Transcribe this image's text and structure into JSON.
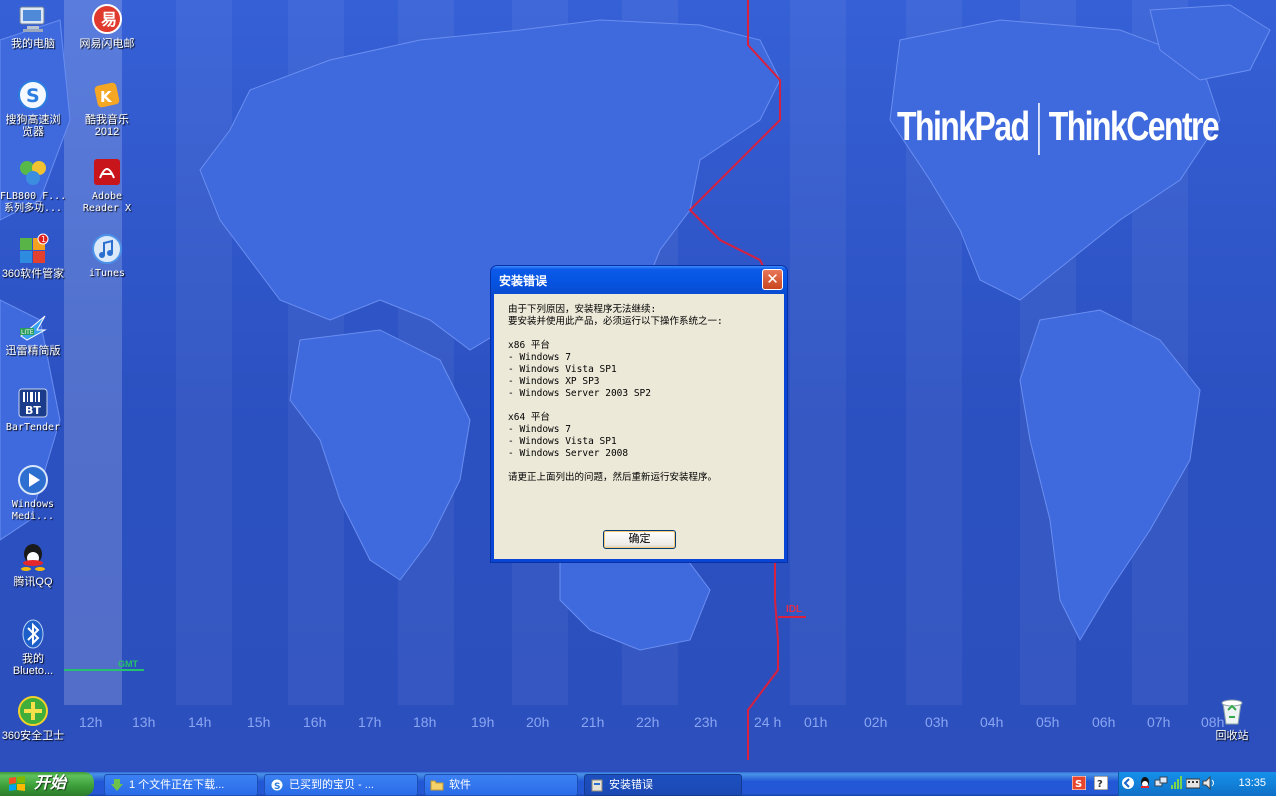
{
  "wallpaper": {
    "brand_left": "ThinkPad",
    "brand_right": "ThinkCentre",
    "idl_label": "IDL",
    "tz_label": "GMT",
    "hours": [
      "12h",
      "13h",
      "14h",
      "15h",
      "16h",
      "17h",
      "18h",
      "19h",
      "20h",
      "21h",
      "22h",
      "23h",
      "24 h",
      "01h",
      "02h",
      "03h",
      "04h",
      "05h",
      "06h",
      "07h",
      "08h"
    ]
  },
  "desktop_icons": [
    {
      "label": "我的电脑",
      "icon": "my-computer-icon"
    },
    {
      "label": "网易闪电邮",
      "icon": "netease-mail-icon"
    },
    {
      "label": "搜狗高速浏览器",
      "icon": "sogou-browser-icon"
    },
    {
      "label": "酷我音乐2012",
      "icon": "kuwo-music-icon"
    },
    {
      "label": "FLB800_F...系列多功...",
      "icon": "flb800-icon"
    },
    {
      "label": "Adobe Reader X",
      "icon": "adobe-reader-icon"
    },
    {
      "label": "360软件管家",
      "icon": "360-software-icon"
    },
    {
      "label": "iTunes",
      "icon": "itunes-icon"
    },
    {
      "label": "迅雷精简版",
      "icon": "xunlei-icon"
    },
    {
      "label": "BarTender",
      "icon": "bartender-icon"
    },
    {
      "label": "Windows Medi...",
      "icon": "windows-media-icon"
    },
    {
      "label": "腾讯QQ",
      "icon": "qq-icon"
    },
    {
      "label": "我的Blueto...",
      "icon": "bluetooth-icon"
    },
    {
      "label": "360安全卫士",
      "icon": "360-safe-icon"
    },
    {
      "label": "回收站",
      "icon": "recycle-bin-icon"
    }
  ],
  "dialog": {
    "title": "安装错误",
    "close_glyph": "✕",
    "message": "由于下列原因，安装程序无法继续:\n要安装并使用此产品，必须运行以下操作系统之一:\n\nx86 平台\n- Windows 7\n- Windows Vista SP1\n- Windows XP SP3\n- Windows Server 2003 SP2\n\nx64 平台\n- Windows 7\n- Windows Vista SP1\n- Windows Server 2008\n\n请更正上面列出的问题，然后重新运行安装程序。",
    "ok_label": "确定"
  },
  "taskbar": {
    "start_label": "开始",
    "tasks": [
      {
        "label": "1 个文件正在下载...",
        "icon": "download-icon",
        "active": false
      },
      {
        "label": "已买到的宝贝 - ...",
        "icon": "sogou-browser-icon",
        "active": false
      },
      {
        "label": "软件",
        "icon": "folder-icon",
        "active": false
      },
      {
        "label": "安装错误",
        "icon": "installer-icon",
        "active": true
      }
    ],
    "clock": "13:35"
  },
  "colors": {
    "desktop_blue": "#2f55c4",
    "idl_red": "#d8203f",
    "dialog_face": "#ece9d8",
    "title_blue": "#0553e0",
    "taskbar_blue": "#2557d4",
    "start_green": "#3a9d38"
  }
}
